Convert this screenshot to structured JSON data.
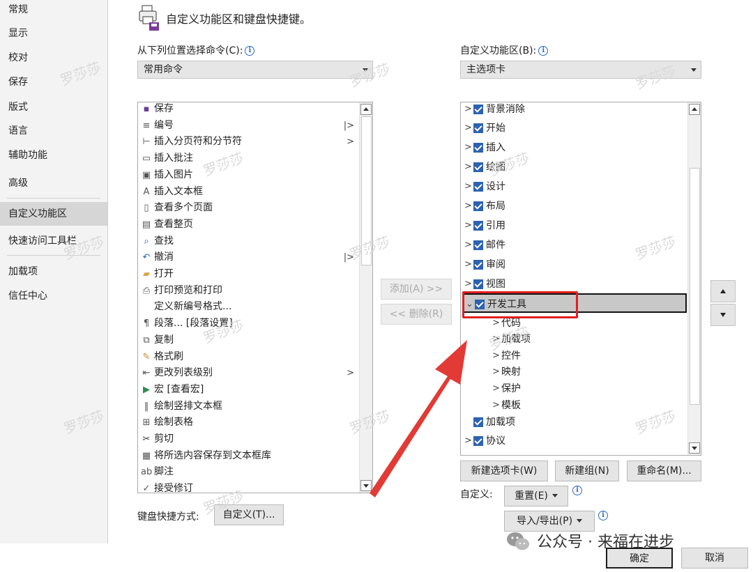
{
  "nav": {
    "items": [
      "常规",
      "显示",
      "校对",
      "保存",
      "版式",
      "语言",
      "辅助功能",
      "高级",
      "自定义功能区",
      "快速访问工具栏",
      "加载项",
      "信任中心"
    ],
    "selected": "自定义功能区"
  },
  "header": {
    "title": "自定义功能区和键盘快捷键。"
  },
  "left": {
    "label": "从下列位置选择命令(C):",
    "combo_value": "常用命令",
    "commands": [
      {
        "icon": "save-icon",
        "text": "保存",
        "submenu": ""
      },
      {
        "icon": "numbering-icon",
        "text": "编号",
        "submenu": "|>"
      },
      {
        "icon": "page-break-icon",
        "text": "插入分页符和分节符",
        "submenu": ">"
      },
      {
        "icon": "comment-icon",
        "text": "插入批注",
        "submenu": ""
      },
      {
        "icon": "picture-icon",
        "text": "插入图片",
        "submenu": ""
      },
      {
        "icon": "textbox-icon",
        "text": "插入文本框",
        "submenu": ""
      },
      {
        "icon": "multi-page-icon",
        "text": "查看多个页面",
        "submenu": ""
      },
      {
        "icon": "page-icon",
        "text": "查看整页",
        "submenu": ""
      },
      {
        "icon": "find-icon",
        "text": "查找",
        "submenu": ""
      },
      {
        "icon": "undo-icon",
        "text": "撤消",
        "submenu": "|>"
      },
      {
        "icon": "folder-icon",
        "text": "打开",
        "submenu": ""
      },
      {
        "icon": "print-preview-icon",
        "text": "打印预览和打印",
        "submenu": ""
      },
      {
        "icon": "",
        "text": "定义新编号格式...",
        "submenu": ""
      },
      {
        "icon": "paragraph-icon",
        "text": "段落... [段落设置]",
        "submenu": ""
      },
      {
        "icon": "copy-icon",
        "text": "复制",
        "submenu": ""
      },
      {
        "icon": "format-painter-icon",
        "text": "格式刷",
        "submenu": ""
      },
      {
        "icon": "list-level-icon",
        "text": "更改列表级别",
        "submenu": ">"
      },
      {
        "icon": "macro-icon",
        "text": "宏 [查看宏]",
        "submenu": ""
      },
      {
        "icon": "vertical-textbox-icon",
        "text": "绘制竖排文本框",
        "submenu": ""
      },
      {
        "icon": "draw-table-icon",
        "text": "绘制表格",
        "submenu": ""
      },
      {
        "icon": "cut-icon",
        "text": "剪切",
        "submenu": ""
      },
      {
        "icon": "save-selection-icon",
        "text": "将所选内容保存到文本框库",
        "submenu": ""
      },
      {
        "icon": "footnote-icon",
        "text": "脚注",
        "submenu": ""
      },
      {
        "icon": "accept-change-icon",
        "text": "接受修订",
        "submenu": ""
      }
    ]
  },
  "right": {
    "label": "自定义功能区(B):",
    "combo_value": "主选项卡",
    "tabs": [
      {
        "text": "背景消除",
        "level": 0,
        "checked": true,
        "expander": ">"
      },
      {
        "text": "开始",
        "level": 0,
        "checked": true,
        "expander": ">"
      },
      {
        "text": "插入",
        "level": 0,
        "checked": true,
        "expander": ">"
      },
      {
        "text": "绘图",
        "level": 0,
        "checked": true,
        "expander": ">"
      },
      {
        "text": "设计",
        "level": 0,
        "checked": true,
        "expander": ">"
      },
      {
        "text": "布局",
        "level": 0,
        "checked": true,
        "expander": ">"
      },
      {
        "text": "引用",
        "level": 0,
        "checked": true,
        "expander": ">"
      },
      {
        "text": "邮件",
        "level": 0,
        "checked": true,
        "expander": ">"
      },
      {
        "text": "审阅",
        "level": 0,
        "checked": true,
        "expander": ">"
      },
      {
        "text": "视图",
        "level": 0,
        "checked": true,
        "expander": ">"
      },
      {
        "text": "开发工具",
        "level": 0,
        "checked": true,
        "expander": "v",
        "selected": true
      },
      {
        "text": "代码",
        "level": 1,
        "checked": false,
        "expander": ">"
      },
      {
        "text": "加载项",
        "level": 1,
        "checked": false,
        "expander": ">"
      },
      {
        "text": "控件",
        "level": 1,
        "checked": false,
        "expander": ">"
      },
      {
        "text": "映射",
        "level": 1,
        "checked": false,
        "expander": ">"
      },
      {
        "text": "保护",
        "level": 1,
        "checked": false,
        "expander": ">"
      },
      {
        "text": "模板",
        "level": 1,
        "checked": false,
        "expander": ">"
      },
      {
        "text": "加载项",
        "level": 0,
        "checked": true,
        "expander": ""
      },
      {
        "text": "协议",
        "level": 0,
        "checked": true,
        "expander": ">"
      }
    ]
  },
  "buttons": {
    "add": "添加(A) >>",
    "remove": "<< 删除(R)",
    "new_tab": "新建选项卡(W)",
    "new_group": "新建组(N)",
    "rename": "重命名(M)...",
    "customize_label": "自定义:",
    "reset": "重置(E)",
    "import_export": "导入/导出(P)",
    "keyboard_label": "键盘快捷方式:",
    "keyboard_customize": "自定义(T)...",
    "ok": "确定",
    "cancel": "取消"
  },
  "watermark": "罗莎莎",
  "wechat_caption": "公众号 · 来福在进步",
  "colors": {
    "checkbox": "#2d62b0",
    "highlight": "#e02020",
    "selected_nav": "#d6d6d6"
  }
}
